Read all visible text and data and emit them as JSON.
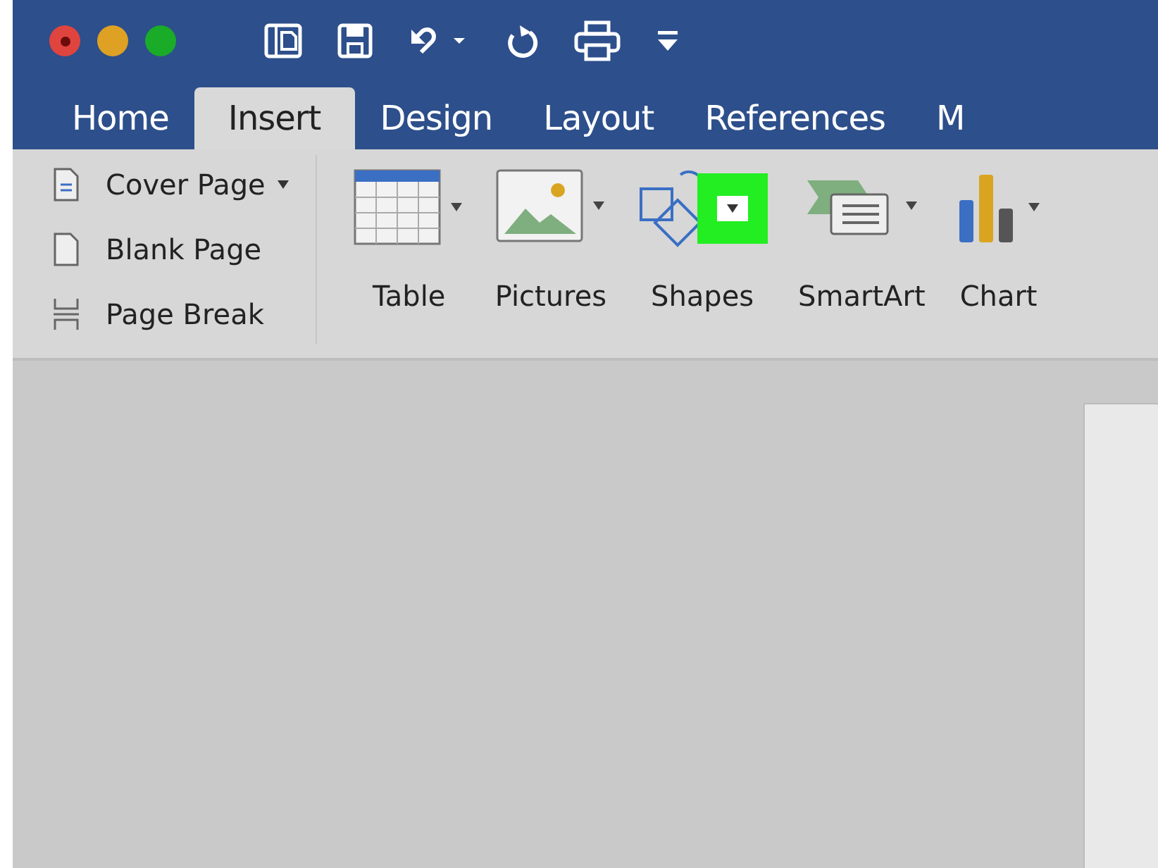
{
  "window_controls": [
    {
      "kind": "close",
      "color": "#e0443e"
    },
    {
      "kind": "minimize",
      "color": "#dea123"
    },
    {
      "kind": "zoom",
      "color": "#1aab29"
    }
  ],
  "tabs": [
    {
      "label": "Home",
      "selected": false
    },
    {
      "label": "Insert",
      "selected": true
    },
    {
      "label": "Design",
      "selected": false
    },
    {
      "label": "Layout",
      "selected": false
    },
    {
      "label": "References",
      "selected": false
    },
    {
      "label": "M",
      "selected": false
    }
  ],
  "page_items": [
    {
      "kind": "cover",
      "label": "Cover Page",
      "has_menu": true
    },
    {
      "kind": "blank",
      "label": "Blank Page",
      "has_menu": false
    },
    {
      "kind": "break",
      "label": "Page Break",
      "has_menu": false
    }
  ],
  "insert_buttons": [
    {
      "kind": "table",
      "label": "Table",
      "highlighted": false
    },
    {
      "kind": "pictures",
      "label": "Pictures",
      "highlighted": false
    },
    {
      "kind": "shapes",
      "label": "Shapes",
      "highlighted": true
    },
    {
      "kind": "smartart",
      "label": "SmartArt",
      "highlighted": false
    },
    {
      "kind": "chart",
      "label": "Chart",
      "highlighted": false
    }
  ]
}
